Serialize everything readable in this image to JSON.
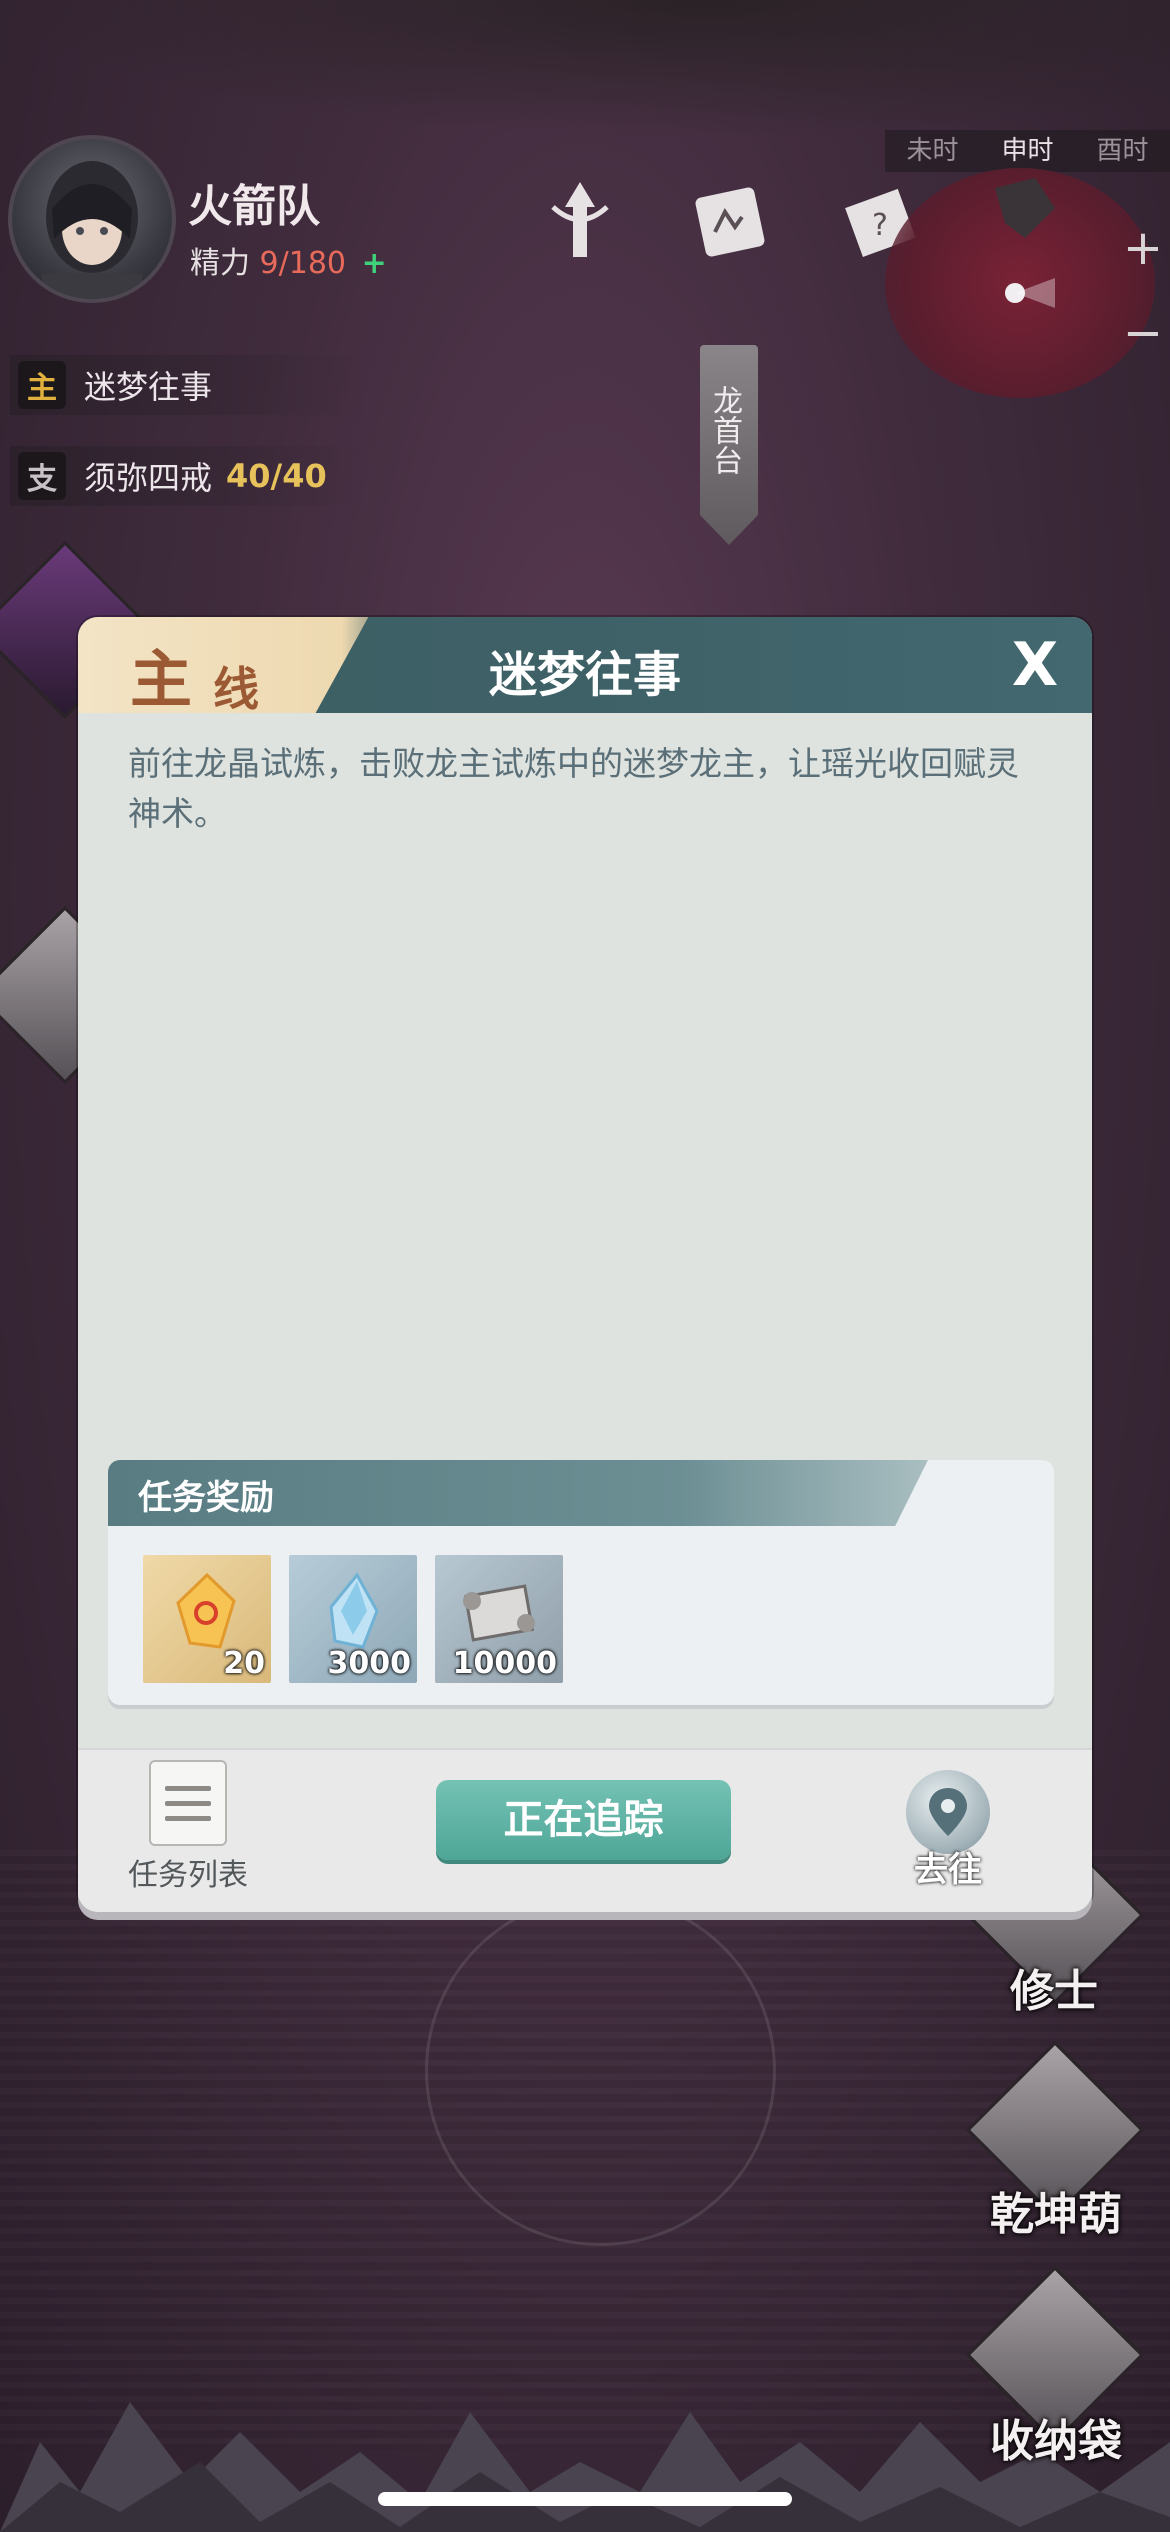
{
  "player": {
    "name": "火箭队",
    "energy_label": "精力",
    "energy_current": "9",
    "energy_max": "/180",
    "energy_add": "+"
  },
  "top_icons": [
    "totem-icon",
    "scroll-map-icon",
    "quest-scroll-icon"
  ],
  "time_bar": {
    "slots": [
      "未时",
      "申时",
      "酉时"
    ],
    "active_index": 1
  },
  "minimap": {
    "zoom_in": "+",
    "zoom_out": "−"
  },
  "quest_tracker": {
    "main": {
      "tag": "主",
      "title": "迷梦往事"
    },
    "side": {
      "tag": "支",
      "title": "须弥四戒",
      "progress": "40/40"
    }
  },
  "location": {
    "name": "龙首台"
  },
  "side_menu": {
    "cultivator": "修士",
    "gourd": "乾坤葫",
    "storage_bag": "收纳袋"
  },
  "dialog": {
    "tag_big": "主",
    "tag_small": "线",
    "title": "迷梦往事",
    "close": "X",
    "description": "前往龙晶试炼，击败龙主试炼中的迷梦龙主，让瑶光收回赋灵神术。",
    "rewards": {
      "header": "任务奖励",
      "items": [
        {
          "icon": "orange-crystal-icon",
          "qty": "20"
        },
        {
          "icon": "blue-crystal-icon",
          "qty": "3000"
        },
        {
          "icon": "scroll-icon",
          "qty": "10000"
        }
      ]
    },
    "footer": {
      "task_list": "任务列表",
      "tracking": "正在追踪",
      "goto": "去往"
    }
  },
  "colors": {
    "dialog_header": "#3e6167",
    "tag_text": "#9c5a34",
    "track_button": "#5fb3a5",
    "energy_current": "#e86a5a",
    "progress": "#e7c15a"
  }
}
